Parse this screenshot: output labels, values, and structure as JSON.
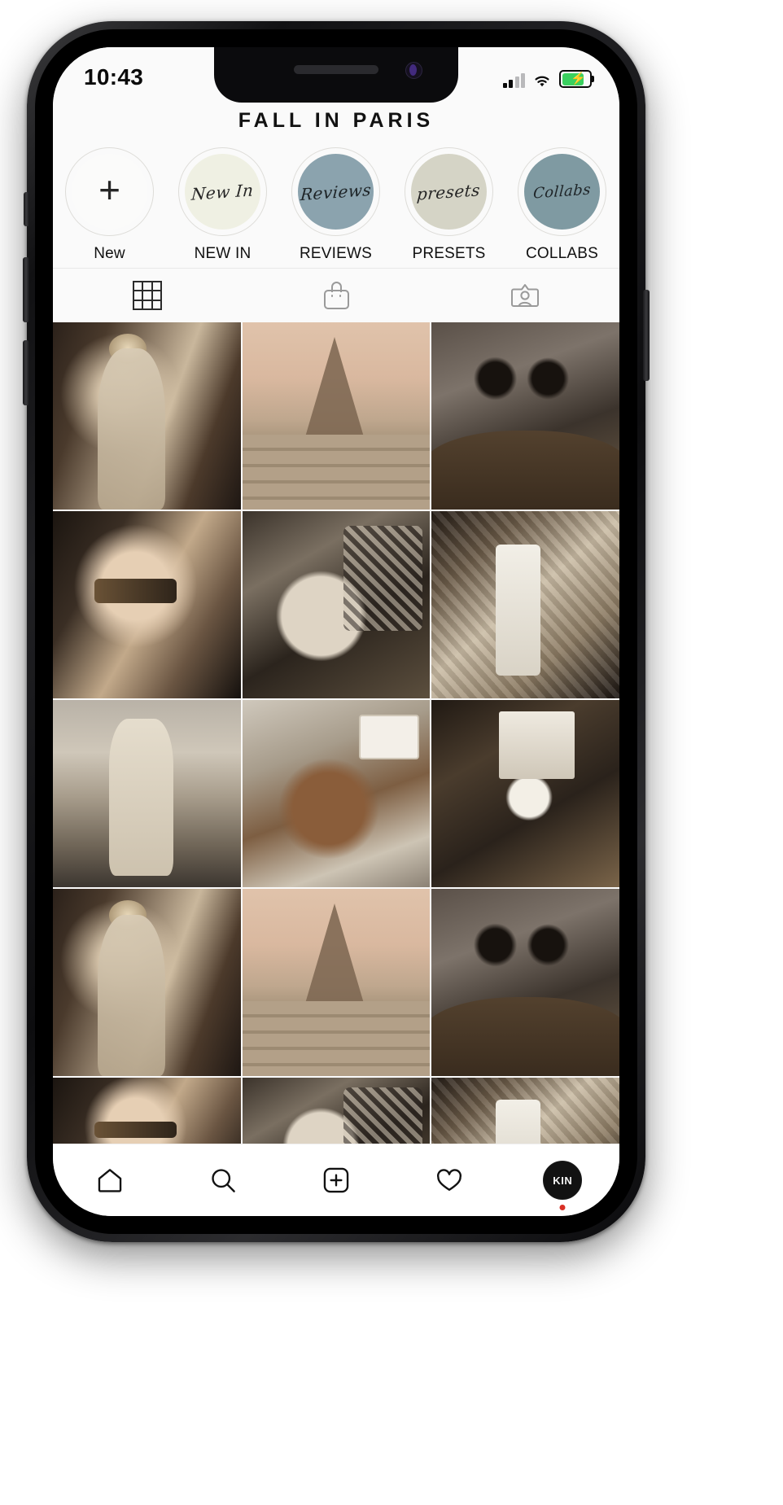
{
  "status_bar": {
    "time": "10:43",
    "signal_icon": "cellular-signal-icon",
    "wifi_icon": "wifi-icon",
    "battery_icon": "battery-charging-icon",
    "battery_level": "75"
  },
  "profile": {
    "title": "FALL IN PARIS"
  },
  "highlights": [
    {
      "label": "New",
      "cover_text": "",
      "cover_color": "#fbfbfa",
      "is_add": true,
      "name": "highlight-new"
    },
    {
      "label": "NEW IN",
      "cover_text": "New In",
      "cover_color": "#eff0e3",
      "is_add": false,
      "name": "highlight-new-in"
    },
    {
      "label": "REVIEWS",
      "cover_text": "Reviews",
      "cover_color": "#8ba3ae",
      "is_add": false,
      "name": "highlight-reviews"
    },
    {
      "label": "PRESETS",
      "cover_text": "presets",
      "cover_color": "#d5d4c6",
      "is_add": false,
      "name": "highlight-presets"
    },
    {
      "label": "COLLABS",
      "cover_text": "Collabs",
      "cover_color": "#7f9aa2",
      "is_add": false,
      "name": "highlight-collabs"
    }
  ],
  "content_tabs": [
    {
      "icon": "grid-icon",
      "label": "Posts",
      "active": true
    },
    {
      "icon": "shopping-bag-icon",
      "label": "Shop",
      "active": false
    },
    {
      "icon": "tagged-photos-icon",
      "label": "Tagged",
      "active": false
    }
  ],
  "photo_grid": [
    {
      "alt": "Woman in beige coat on Paris street",
      "style": "p-street"
    },
    {
      "alt": "Couple by the Eiffel Tower at sunset",
      "style": "p-eiffel"
    },
    {
      "alt": "Two espresso cups on cafe table",
      "style": "p-coffee"
    },
    {
      "alt": "Portrait with leopard sunglasses",
      "style": "p-sunglass"
    },
    {
      "alt": "Cafe table with bag, book and coffee",
      "style": "p-cafetable"
    },
    {
      "alt": "Checked blazer over white shirt",
      "style": "p-blazer"
    },
    {
      "alt": "Beige scarf outfit at the beach",
      "style": "p-beach"
    },
    {
      "alt": "Camel trench coat on a pier",
      "style": "p-trench"
    },
    {
      "alt": "Espresso, camera and magazine",
      "style": "p-espresso"
    },
    {
      "alt": "Woman in beige coat on Paris street",
      "style": "p-street"
    },
    {
      "alt": "Couple by the Eiffel Tower at sunset",
      "style": "p-eiffel"
    },
    {
      "alt": "Two espresso cups on cafe table",
      "style": "p-coffee"
    },
    {
      "alt": "Portrait with leopard sunglasses",
      "style": "p-sunglass"
    },
    {
      "alt": "Cafe table with bag, book and coffee",
      "style": "p-cafetable"
    },
    {
      "alt": "Checked blazer over white shirt",
      "style": "p-blazer"
    }
  ],
  "bottom_nav": [
    {
      "icon": "home-icon",
      "label": "Home",
      "name": "nav-home"
    },
    {
      "icon": "search-icon",
      "label": "Search",
      "name": "nav-search"
    },
    {
      "icon": "add-post-icon",
      "label": "Create",
      "name": "nav-create"
    },
    {
      "icon": "heart-icon",
      "label": "Activity",
      "name": "nav-activity"
    },
    {
      "icon": "profile-avatar",
      "label": "Profile",
      "name": "nav-profile",
      "avatar_text": "KIN",
      "has_badge": true
    }
  ],
  "colors": {
    "screen_bg": "#fafafa",
    "text_primary": "#121212",
    "icon_inactive": "#9a9a9a",
    "battery_green": "#3ad05f",
    "badge_red": "#d93025"
  }
}
